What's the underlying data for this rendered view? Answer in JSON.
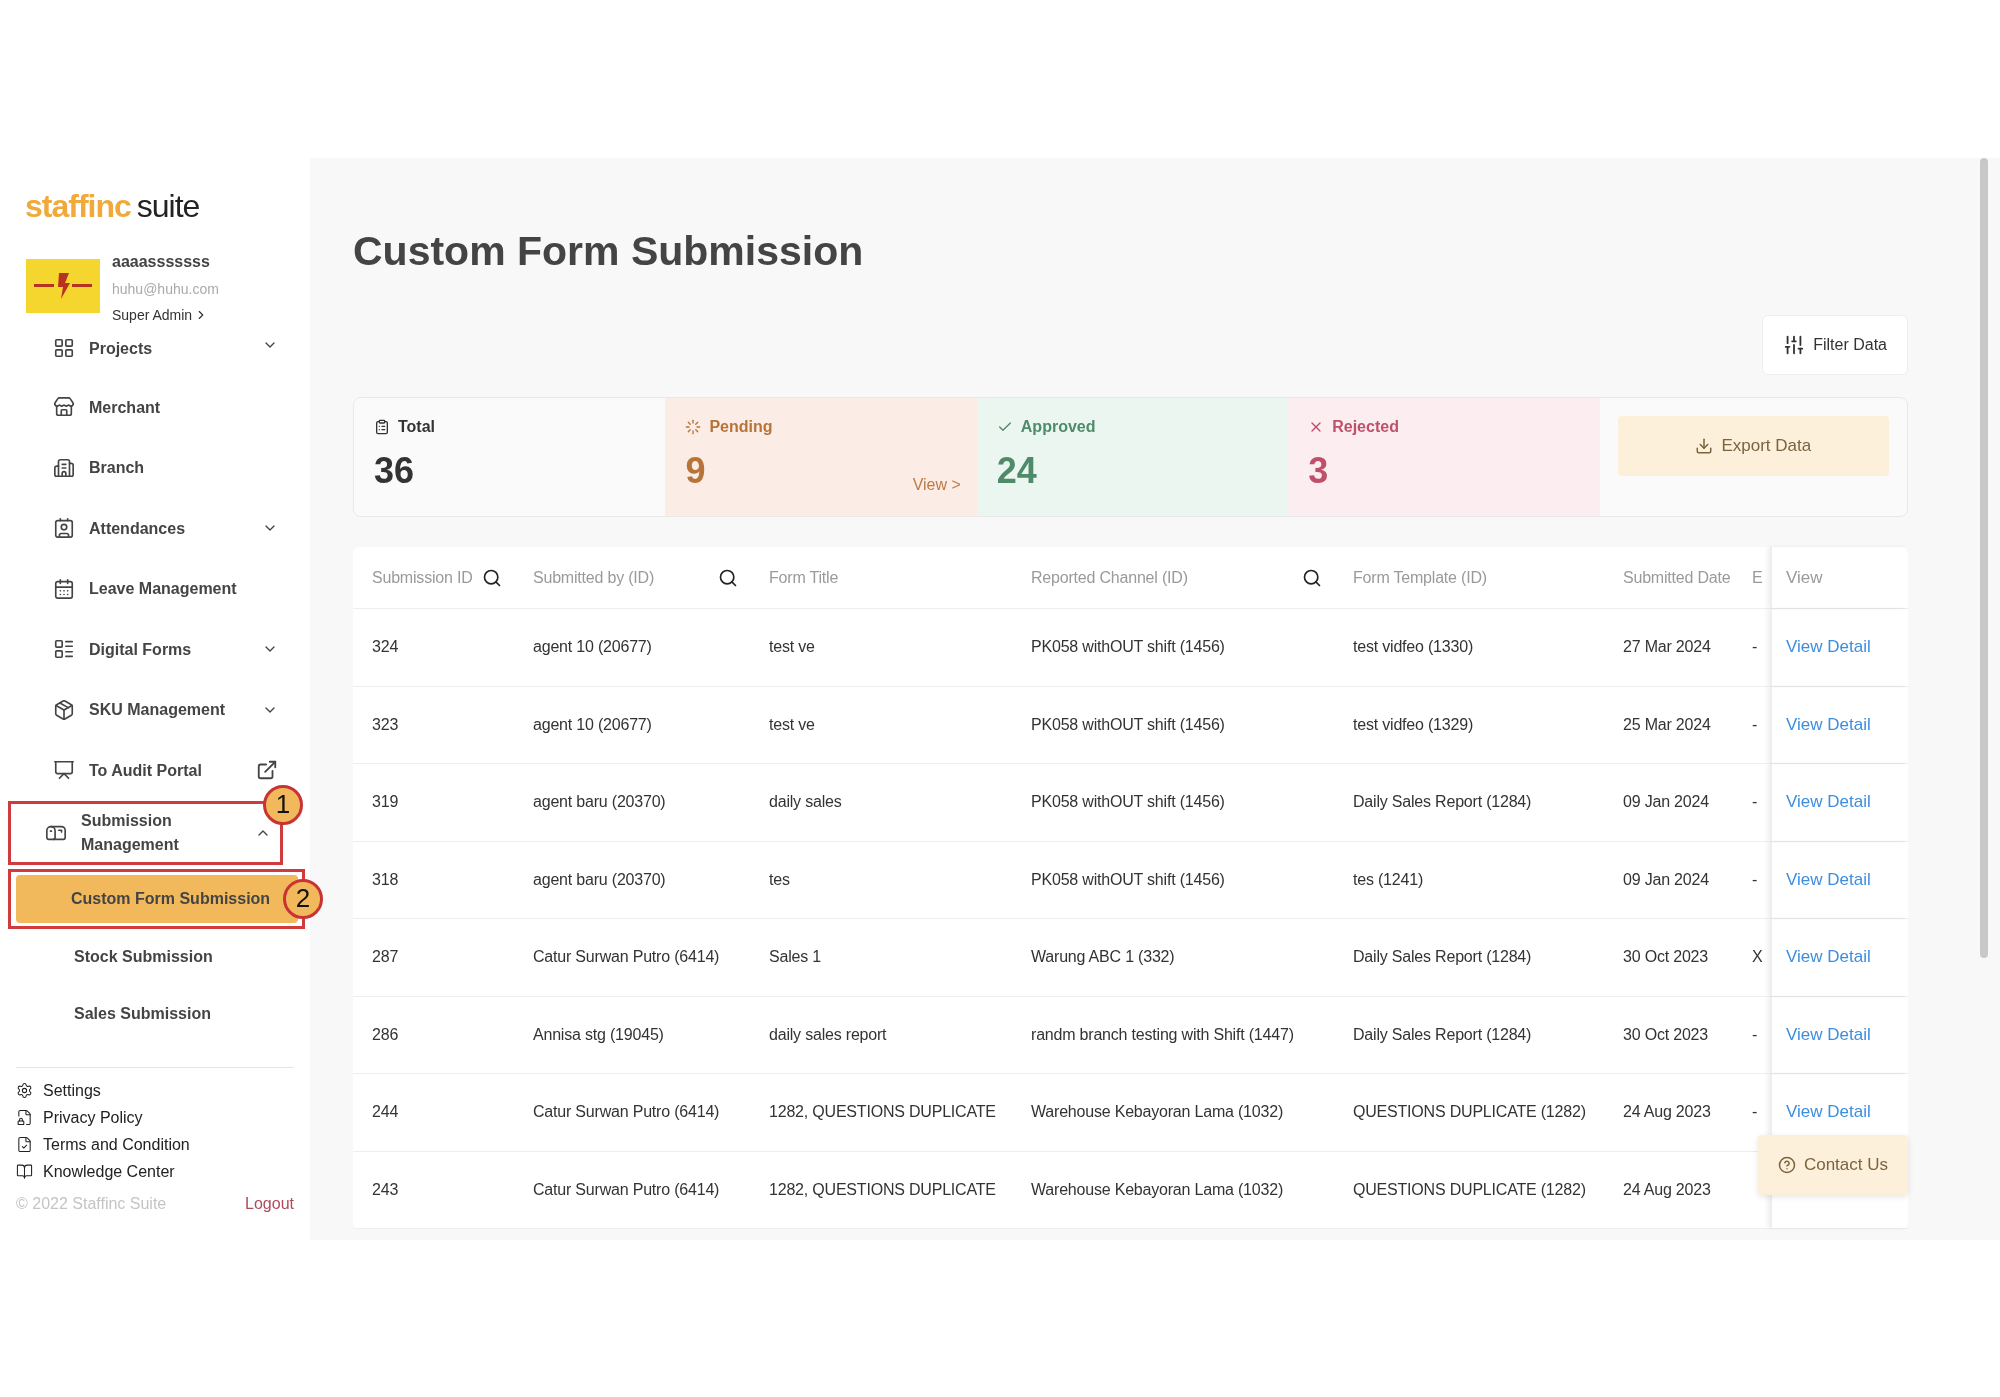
{
  "sidebar": {
    "logo": {
      "brand": "staffinc",
      "suffix": "suite"
    },
    "profile": {
      "name": "aaaasssssss",
      "email": "huhu@huhu.com",
      "role": "Super Admin"
    },
    "nav": [
      {
        "label": "Projects",
        "expandable": true,
        "expanded": false
      },
      {
        "label": "Merchant"
      },
      {
        "label": "Branch"
      },
      {
        "label": "Attendances",
        "expandable": true,
        "expanded": false
      },
      {
        "label": "Leave Management"
      },
      {
        "label": "Digital Forms",
        "expandable": true,
        "expanded": false
      },
      {
        "label": "SKU Management",
        "expandable": true,
        "expanded": false
      },
      {
        "label": "To Audit Portal",
        "external": true
      },
      {
        "label": "Submission Management",
        "expandable": true,
        "expanded": true,
        "callout": "1",
        "children": [
          {
            "label": "Custom Form Submission",
            "selected": true,
            "callout": "2"
          },
          {
            "label": "Stock Submission",
            "selected": false
          },
          {
            "label": "Sales Submission",
            "selected": false
          }
        ]
      }
    ],
    "footer_links": [
      "Settings",
      "Privacy Policy",
      "Terms and Condition",
      "Knowledge Center"
    ],
    "copyright": "© 2022 Staffinc Suite",
    "logout": "Logout"
  },
  "main": {
    "title": "Custom Form Submission",
    "filter_button": "Filter Data",
    "stats": [
      {
        "kind": "total",
        "label": "Total",
        "value": "36"
      },
      {
        "kind": "pending",
        "label": "Pending",
        "value": "9",
        "link": "View >"
      },
      {
        "kind": "approved",
        "label": "Approved",
        "value": "24"
      },
      {
        "kind": "rejected",
        "label": "Rejected",
        "value": "3"
      }
    ],
    "export_button": "Export Data",
    "table": {
      "columns": [
        {
          "label": "Submission ID",
          "searchable": true
        },
        {
          "label": "Submitted by (ID)",
          "searchable": true
        },
        {
          "label": "Form Title"
        },
        {
          "label": "Reported Channel (ID)",
          "searchable": true
        },
        {
          "label": "Form Template (ID)"
        },
        {
          "label": "Submitted Date"
        },
        {
          "label": "E"
        },
        {
          "label": "View"
        }
      ],
      "rows": [
        {
          "cells": [
            "324",
            "agent 10 (20677)",
            "test ve",
            "PK058 withOUT shift (1456)",
            "test vidfeo (1330)",
            "27 Mar 2024",
            "-"
          ],
          "link": "View Detail"
        },
        {
          "cells": [
            "323",
            "agent 10 (20677)",
            "test ve",
            "PK058 withOUT shift (1456)",
            "test vidfeo (1329)",
            "25 Mar 2024",
            "-"
          ],
          "link": "View Detail"
        },
        {
          "cells": [
            "319",
            "agent baru (20370)",
            "daily sales",
            "PK058 withOUT shift (1456)",
            "Daily Sales Report (1284)",
            "09 Jan 2024",
            "-"
          ],
          "link": "View Detail"
        },
        {
          "cells": [
            "318",
            "agent baru (20370)",
            "tes",
            "PK058 withOUT shift (1456)",
            "tes (1241)",
            "09 Jan 2024",
            "-"
          ],
          "link": "View Detail"
        },
        {
          "cells": [
            "287",
            "Catur Surwan Putro (6414)",
            "Sales 1",
            "Warung ABC 1 (332)",
            "Daily Sales Report (1284)",
            "30 Oct 2023",
            "X"
          ],
          "link": "View Detail"
        },
        {
          "cells": [
            "286",
            "Annisa stg (19045)",
            "daily sales report",
            "randm branch testing with Shift (1447)",
            "Daily Sales Report (1284)",
            "30 Oct 2023",
            "-"
          ],
          "link": "View Detail"
        },
        {
          "cells": [
            "244",
            "Catur Surwan Putro (6414)",
            "1282, QUESTIONS DUPLICATE",
            "Warehouse Kebayoran Lama (1032)",
            "QUESTIONS DUPLICATE (1282)",
            "24 Aug 2023",
            "-"
          ],
          "link": "View Detail"
        },
        {
          "cells": [
            "243",
            "Catur Surwan Putro (6414)",
            "1282, QUESTIONS DUPLICATE",
            "Warehouse Kebayoran Lama (1032)",
            "QUESTIONS DUPLICATE (1282)",
            "24 Aug 2023"
          ]
        }
      ]
    },
    "contact_button": "Contact Us"
  }
}
